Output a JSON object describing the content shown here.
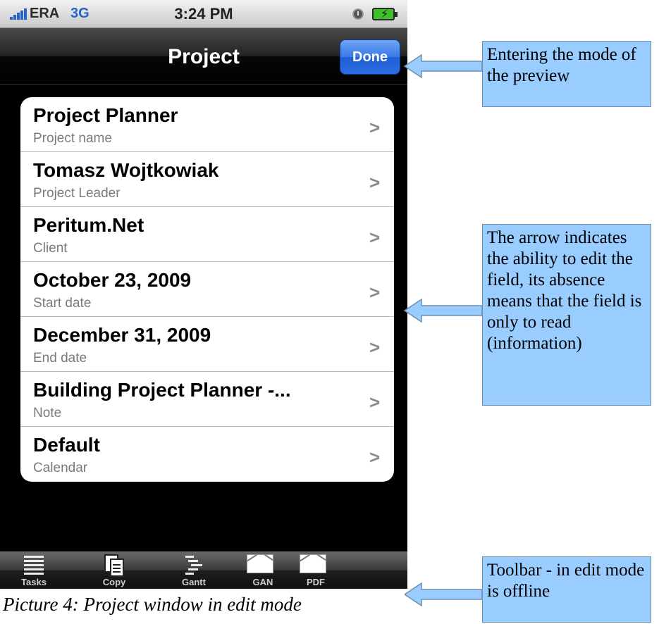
{
  "status_bar": {
    "carrier": "ERA",
    "network": "3G",
    "time": "3:24 PM"
  },
  "nav": {
    "title": "Project",
    "done_label": "Done"
  },
  "rows": [
    {
      "title": "Project Planner",
      "subtitle": "Project name"
    },
    {
      "title": "Tomasz Wojtkowiak",
      "subtitle": "Project Leader"
    },
    {
      "title": "Peritum.Net",
      "subtitle": "Client"
    },
    {
      "title": "October 23, 2009",
      "subtitle": "Start date"
    },
    {
      "title": "December 31, 2009",
      "subtitle": "End date"
    },
    {
      "title": "Building Project Planner -...",
      "subtitle": "Note"
    },
    {
      "title": "Default",
      "subtitle": "Calendar"
    }
  ],
  "toolbar": {
    "tasks": "Tasks",
    "copy": "Copy",
    "gantt": "Gantt",
    "gan": "GAN",
    "pdf": "PDF"
  },
  "callouts": {
    "done": "Entering the mode of the preview",
    "arrow": "The arrow indicates the ability to edit the field, its absence means that the field is only to read (information)",
    "toolbar": "Toolbar - in edit mode is offline"
  },
  "caption": "Picture 4: Project window in edit mode",
  "colors": {
    "callout_fill": "#99ccff",
    "done_button": "#2c6de0"
  }
}
